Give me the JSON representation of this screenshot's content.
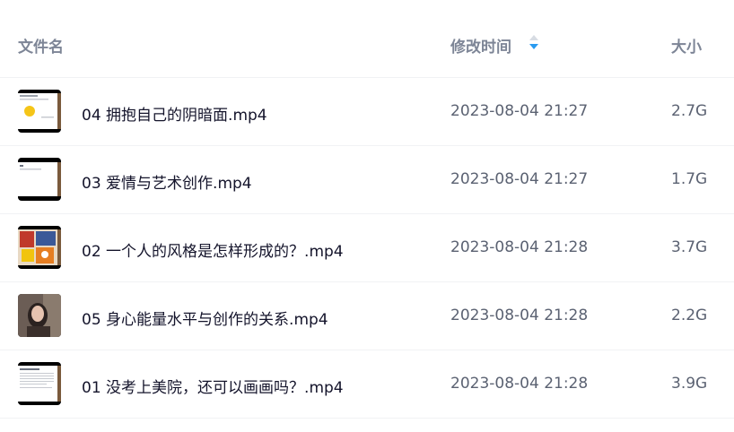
{
  "header": {
    "name_label": "文件名",
    "time_label": "修改时间",
    "size_label": "大小",
    "sort_icon": "sort-icon"
  },
  "files": [
    {
      "name": "04 拥抱自己的阴暗面.mp4",
      "modified": "2023-08-04 21:27",
      "size": "2.7G",
      "thumb": "slide-yellow-circle"
    },
    {
      "name": "03 爱情与艺术创作.mp4",
      "modified": "2023-08-04 21:27",
      "size": "1.7G",
      "thumb": "slide-white-text"
    },
    {
      "name": "02 一个人的风格是怎样形成的？.mp4",
      "modified": "2023-08-04 21:28",
      "size": "3.7G",
      "thumb": "painting-colorful"
    },
    {
      "name": "05 身心能量水平与创作的关系.mp4",
      "modified": "2023-08-04 21:28",
      "size": "2.2G",
      "thumb": "person-portrait"
    },
    {
      "name": "01 没考上美院，还可以画画吗？.mp4",
      "modified": "2023-08-04 21:28",
      "size": "3.9G",
      "thumb": "slide-text-document"
    }
  ],
  "colors": {
    "header_text": "#7d8596",
    "row_text": "#14142b",
    "meta_text": "#5b6272",
    "sort_active": "#2a9bf0",
    "divider": "#f1f2f4"
  }
}
